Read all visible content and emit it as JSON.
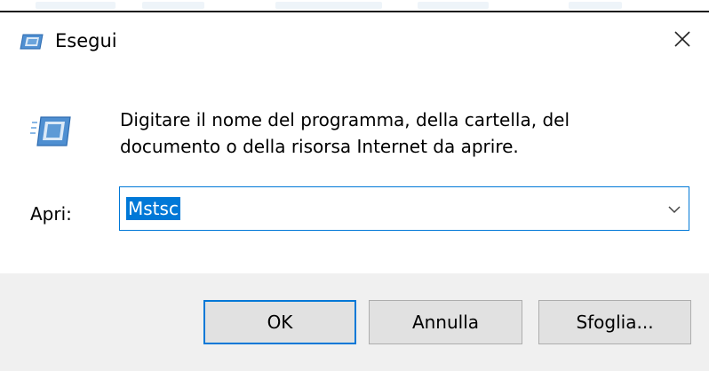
{
  "window": {
    "title": "Esegui",
    "close_symbol": "✕"
  },
  "icons": {
    "title": "run-icon",
    "large": "run-icon",
    "close": "close-icon",
    "dropdown": "chevron-down-icon"
  },
  "main": {
    "description": "Digitare il nome del programma, della cartella, del documento o della risorsa Internet da aprire.",
    "open_label": "Apri:",
    "open_value": "Mstsc"
  },
  "buttons": {
    "ok": "OK",
    "cancel": "Annulla",
    "browse": "Sfoglia..."
  },
  "colors": {
    "accent": "#0078d7",
    "footer_background": "#f0f0f0",
    "button_background": "#e1e1e1"
  }
}
